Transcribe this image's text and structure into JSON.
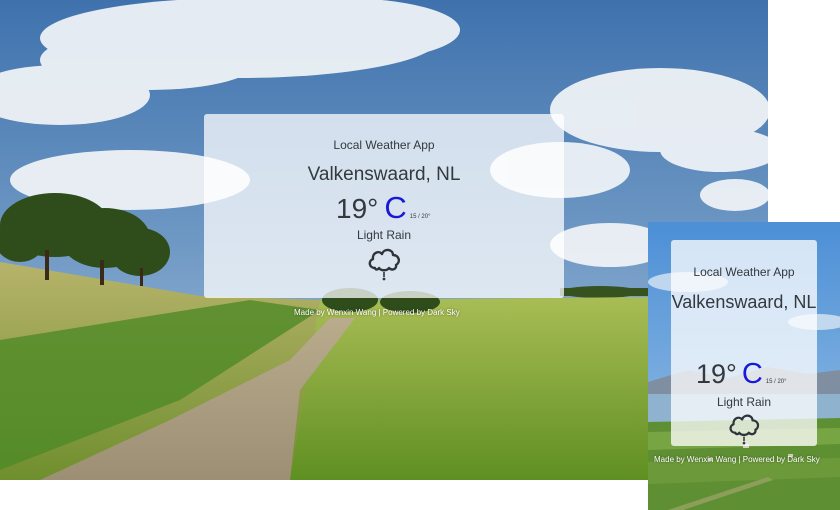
{
  "desktop": {
    "app_title": "Local Weather App",
    "location": "Valkenswaard, NL",
    "temperature": "19°",
    "unit": "C",
    "range": "15 / 20°",
    "condition": "Light Rain",
    "condition_icon": "rain-cloud-icon",
    "credit": "Made by Wenxin Wang | Powered by Dark Sky"
  },
  "mobile": {
    "app_title": "Local Weather App",
    "location": "Valkenswaard, NL",
    "temperature": "19°",
    "unit": "C",
    "range": "15 / 20°",
    "condition": "Light Rain",
    "condition_icon": "rain-cloud-icon",
    "credit": "Made by Wenxin Wang | Powered by Dark Sky"
  },
  "colors": {
    "unit_accent": "#1818d8",
    "text": "#33393e",
    "sky": "#4f80b5",
    "field": "#6f9a34"
  }
}
